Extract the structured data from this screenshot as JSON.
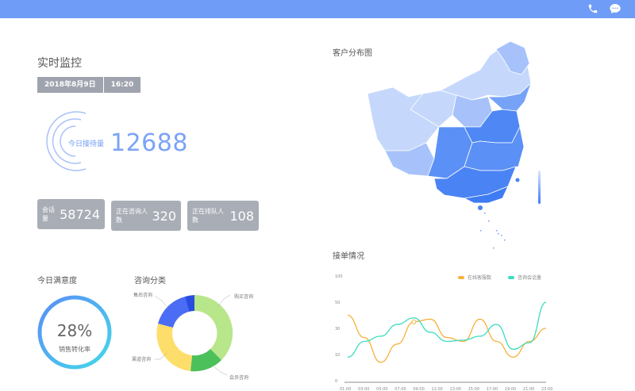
{
  "colors": {
    "accent": "#6f9cf6",
    "orange": "#f7b13d",
    "teal": "#3ddcc0",
    "gray_box": "#a9adb6"
  },
  "topbar": {
    "icons": [
      "phone-icon",
      "chat-icon"
    ]
  },
  "realtime": {
    "title": "实时监控",
    "date": "2018年8月9日",
    "time": "16:20",
    "today_label": "今日接待量",
    "today_value": "12688"
  },
  "stats": [
    {
      "label": "会话量",
      "value": "58724"
    },
    {
      "label": "正在咨询人数",
      "value": "320"
    },
    {
      "label": "正在排队人数",
      "value": "108"
    }
  ],
  "satisfaction": {
    "title": "今日满意度",
    "percent": "28%",
    "label": "销售转化率",
    "fraction": 0.28
  },
  "consult": {
    "title": "咨询分类",
    "labels": [
      "售后咨询",
      "购买咨询",
      "渠道咨询",
      "会员咨询"
    ]
  },
  "map": {
    "title": "客户分布图"
  },
  "orders": {
    "title": "接单情况"
  },
  "chart_data": {
    "type": "line",
    "series": [
      {
        "name": "在线客服数",
        "color": "#f7b13d",
        "values": [
          40,
          23,
          7,
          18,
          35,
          37,
          23,
          20,
          37,
          20,
          9,
          20,
          30
        ]
      },
      {
        "name": "咨询会话量",
        "color": "#3ddcc0",
        "values": [
          9,
          20,
          24,
          33,
          38,
          27,
          20,
          21,
          24,
          33,
          14,
          19,
          50
        ]
      }
    ],
    "x": [
      "01:00",
      "03:00",
      "05:00",
      "07:00",
      "09:00",
      "11:00",
      "13:00",
      "15:00",
      "17:00",
      "19:00",
      "21:00",
      "23:00"
    ],
    "yticks": [
      "100",
      "50",
      "30",
      "10",
      "0"
    ]
  }
}
